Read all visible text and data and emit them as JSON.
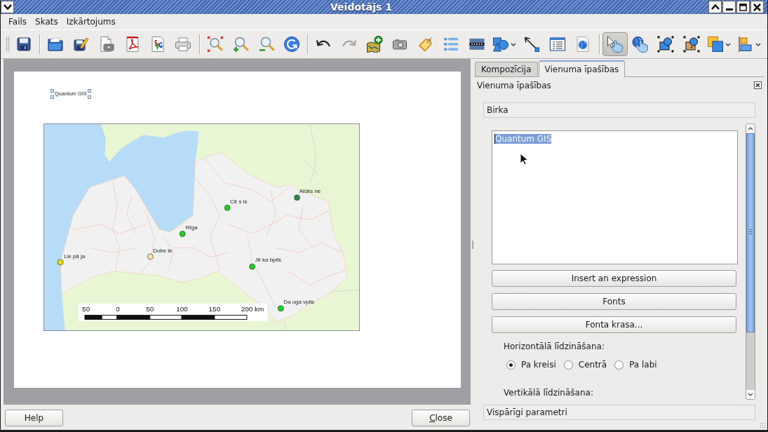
{
  "window": {
    "title": "Veidotājs 1"
  },
  "menu": [
    {
      "label": "Fails"
    },
    {
      "label": "Skats"
    },
    {
      "label": "Izkārtojums"
    }
  ],
  "toolbar": {
    "groups": [
      [
        {
          "selected": false,
          "disabled": false
        }
      ],
      [
        {
          "selected": false,
          "disabled": false
        },
        {
          "selected": false,
          "disabled": false
        },
        {
          "selected": false,
          "disabled": false
        },
        {
          "selected": false,
          "disabled": false
        },
        {
          "selected": false,
          "disabled": false
        },
        {
          "selected": false,
          "disabled": false
        }
      ],
      [
        {
          "selected": false,
          "disabled": false
        },
        {
          "selected": false,
          "disabled": false
        },
        {
          "selected": false,
          "disabled": false
        },
        {
          "selected": false,
          "disabled": false
        }
      ],
      [
        {
          "selected": false,
          "disabled": false
        },
        {
          "selected": false,
          "disabled": true
        },
        {
          "selected": false,
          "disabled": false
        },
        {
          "selected": false,
          "disabled": false
        },
        {
          "selected": false,
          "disabled": false
        },
        {
          "selected": false,
          "disabled": false
        },
        {
          "selected": false,
          "disabled": false
        },
        {
          "selected": false,
          "disabled": false
        },
        {
          "selected": false,
          "disabled": false
        },
        {
          "selected": false,
          "disabled": false
        },
        {
          "selected": false,
          "disabled": false
        }
      ],
      [
        {
          "selected": true,
          "disabled": false
        },
        {
          "selected": false,
          "disabled": false
        },
        {
          "selected": false,
          "disabled": false
        },
        {
          "selected": false,
          "disabled": false
        },
        {
          "selected": false,
          "disabled": false
        },
        {
          "selected": false,
          "disabled": false
        }
      ]
    ]
  },
  "composition": {
    "label_item": {
      "text": "Quantum GIS",
      "selected": true
    },
    "map": {
      "cities": [
        {
          "name": "Lie pā ja",
          "color": "#e8e010"
        },
        {
          "name": "Dobe le",
          "color": "#f8e4a8"
        },
        {
          "name": "Rīga",
          "color": "#1ed21e"
        },
        {
          "name": "Cē s is",
          "color": "#1ed21e"
        },
        {
          "name": "Alūks ne",
          "color": "#2e8b50"
        },
        {
          "name": "Jē ka bpils",
          "color": "#1ed21e"
        },
        {
          "name": "Da uga vpils",
          "color": "#1ed21e"
        }
      ],
      "scale_bar": {
        "labels": [
          "50",
          "0",
          "50",
          "100",
          "150",
          "200 km"
        ]
      }
    }
  },
  "panel": {
    "tabs": [
      {
        "label": "Kompozīcija",
        "selected": false
      },
      {
        "label": "Vienuma īpašības",
        "selected": true
      }
    ],
    "title": "Vienuma īpašības",
    "label_section": {
      "title": "Birka",
      "text": {
        "value": "Quantum GIS",
        "text_selected": true
      },
      "buttons": [
        "Insert an expression",
        "Fonts",
        "Fonta krasa..."
      ],
      "horizontal_alignment": {
        "label": "Horizontālā līdzināšana:",
        "options": [
          {
            "label": "Pa kreisi",
            "selected": true
          },
          {
            "label": "Centrā",
            "selected": false
          },
          {
            "label": "Pa labi",
            "selected": false
          }
        ]
      },
      "vertical_alignment": {
        "label": "Vertikālā līdzināšana:"
      }
    },
    "general_section": {
      "title": "Vispārīgi parametri"
    }
  },
  "dialog_buttons": [
    {
      "label": "Help",
      "mnemonic_underlined": false
    },
    {
      "label": "Close",
      "mnemonic_underlined": true
    }
  ]
}
